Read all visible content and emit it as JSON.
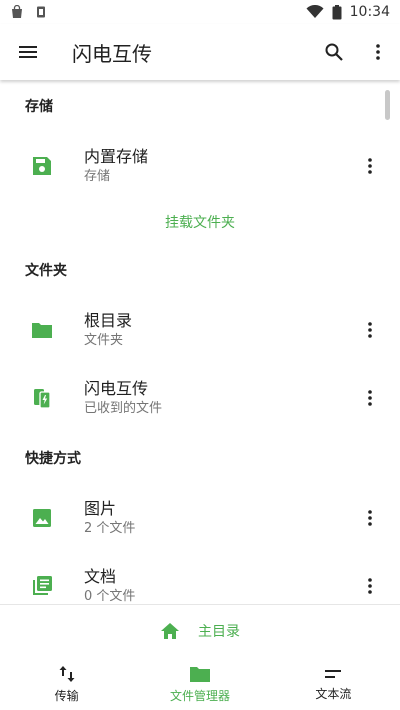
{
  "status_bar": {
    "time": "10:34"
  },
  "app_bar": {
    "title": "闪电互传"
  },
  "sections": {
    "storage": {
      "header": "存储",
      "items": [
        {
          "primary": "内置存储",
          "secondary": "存储"
        }
      ],
      "mount_link": "挂载文件夹"
    },
    "folders": {
      "header": "文件夹",
      "items": [
        {
          "primary": "根目录",
          "secondary": "文件夹"
        },
        {
          "primary": "闪电互传",
          "secondary": "已收到的文件"
        }
      ]
    },
    "shortcuts": {
      "header": "快捷方式",
      "items": [
        {
          "primary": "图片",
          "secondary": "2 个文件"
        },
        {
          "primary": "文档",
          "secondary": "0 个文件"
        }
      ]
    }
  },
  "home": {
    "label": "主目录"
  },
  "bottom_nav": {
    "items": [
      {
        "label": "传输"
      },
      {
        "label": "文件管理器"
      },
      {
        "label": "文本流"
      }
    ],
    "active_index": 1
  },
  "colors": {
    "accent": "#4caf50",
    "text": "#212121",
    "secondary": "#757575"
  }
}
